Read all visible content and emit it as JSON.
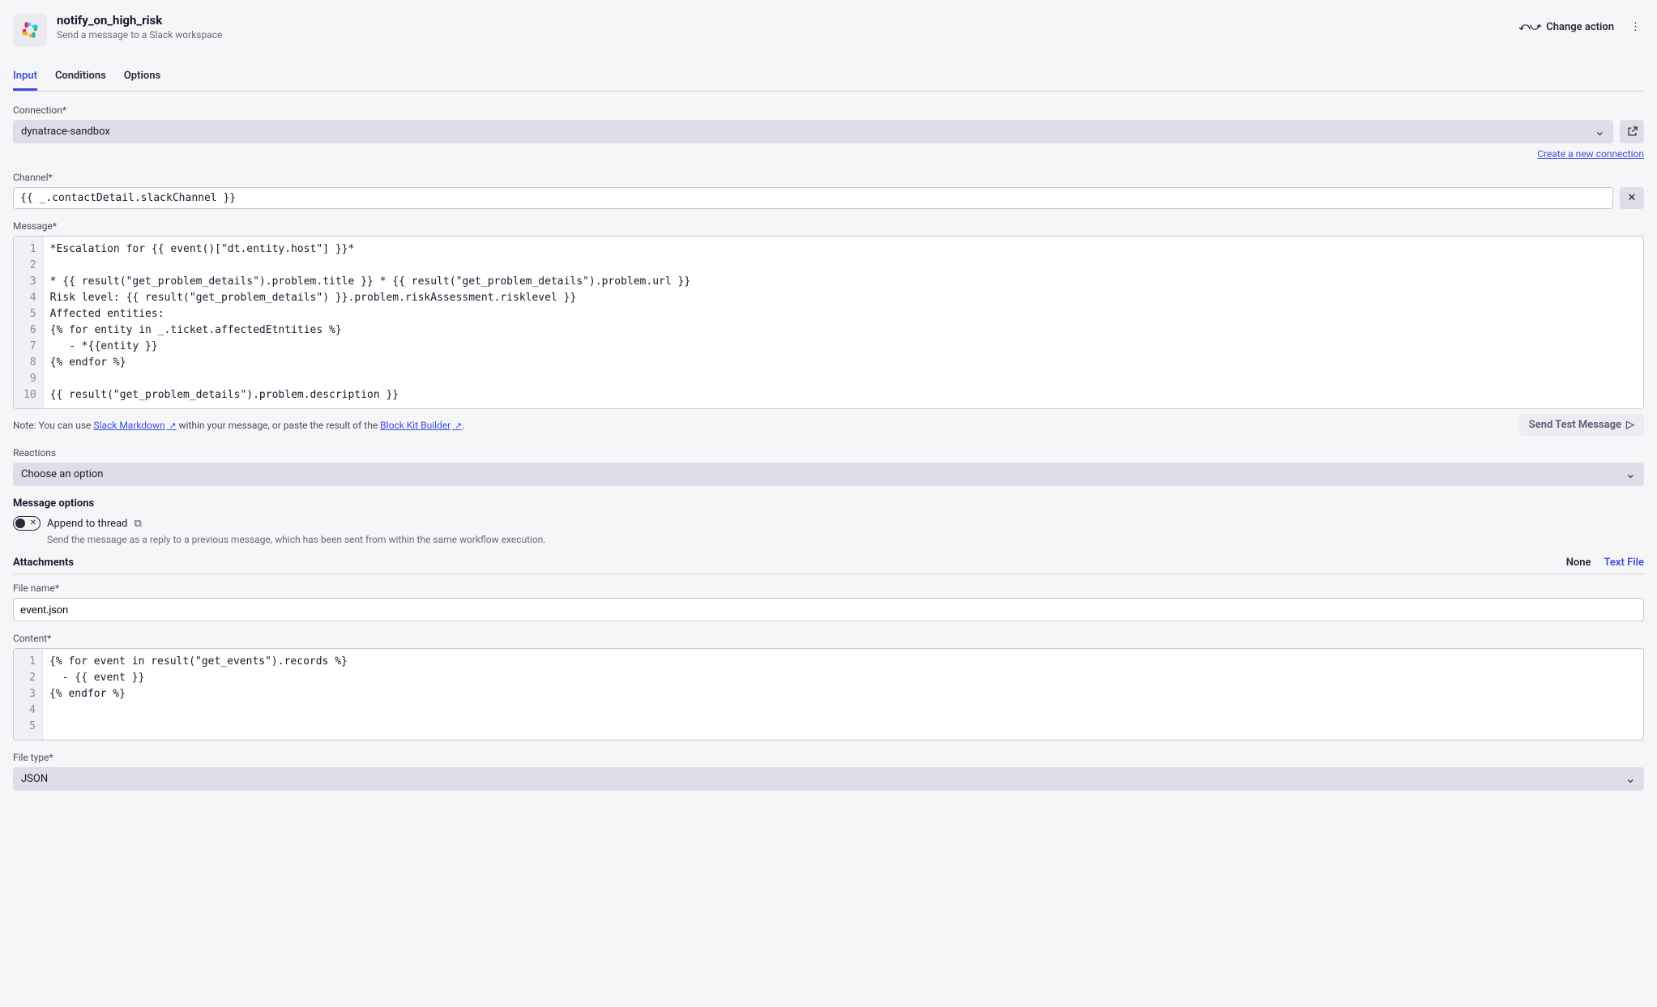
{
  "header": {
    "title": "notify_on_high_risk",
    "subtitle": "Send a message to a Slack workspace",
    "change_action": "Change action"
  },
  "tabs": {
    "input": "Input",
    "conditions": "Conditions",
    "options": "Options"
  },
  "connection": {
    "label": "Connection*",
    "value": "dynatrace-sandbox",
    "create_link": "Create a new connection"
  },
  "channel": {
    "label": "Channel*",
    "value": "{{ _.contactDetail.slackChannel }}"
  },
  "message": {
    "label": "Message*",
    "lines": [
      "*Escalation for {{ event()[\"dt.entity.host\"] }}*",
      "",
      "* {{ result(\"get_problem_details\").problem.title }} * {{ result(\"get_problem_details\").problem.url }}",
      "Risk level: {{ result(\"get_problem_details\") }}.problem.riskAssessment.risklevel }}",
      "Affected entities:",
      "{% for entity in _.ticket.affectedEtntities %}",
      "   - *{{entity }}",
      "{% endfor %}",
      "",
      "{{ result(\"get_problem_details\").problem.description }}"
    ],
    "note_prefix": "Note: You can use ",
    "note_link1": "Slack Markdown",
    "note_mid": " within your message, or paste the result of the ",
    "note_link2": "Block Kit Builder",
    "note_suffix": ".",
    "send_test": "Send Test Message"
  },
  "reactions": {
    "label": "Reactions",
    "placeholder": "Choose an option"
  },
  "msg_options": {
    "title": "Message options",
    "append_label": "Append to thread",
    "help": "Send the message as a reply to a previous message, which has been sent from within the same workflow execution."
  },
  "attachments": {
    "title": "Attachments",
    "none": "None",
    "text_file": "Text File",
    "file_name_label": "File name*",
    "file_name_value": "event.json",
    "content_label": "Content*",
    "content_lines": [
      "{% for event in result(\"get_events\").records %}",
      "  - {{ event }}",
      "{% endfor %}",
      "",
      ""
    ],
    "file_type_label": "File type*",
    "file_type_value": "JSON"
  }
}
